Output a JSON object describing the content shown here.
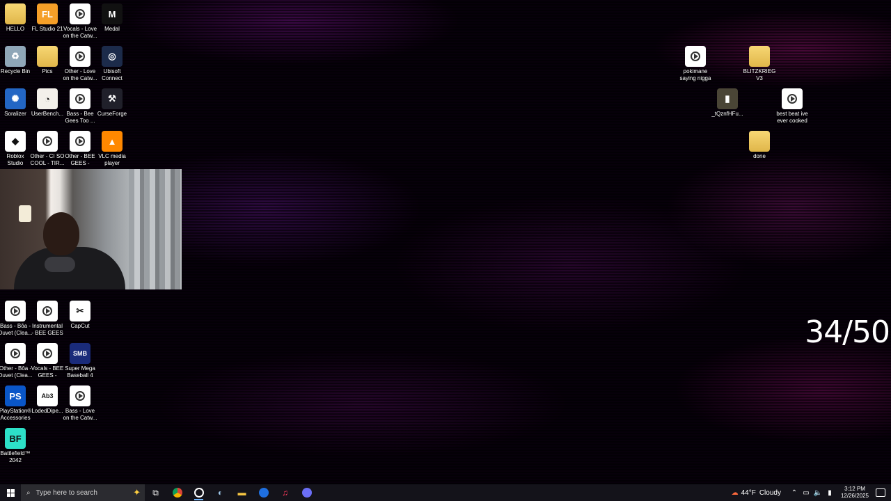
{
  "desktop_icons_left": [
    {
      "id": "hello",
      "label": "HELLO",
      "type": "folder"
    },
    {
      "id": "fl-studio",
      "label": "FL Studio 21",
      "type": "app",
      "color": "#f59f28",
      "glyph": "FL"
    },
    {
      "id": "vocals-love",
      "label": "Vocals - Love\non the Catw...",
      "type": "media"
    },
    {
      "id": "medal",
      "label": "Medal",
      "type": "app",
      "color": "#111",
      "glyph": "M"
    },
    {
      "id": "recycle-bin",
      "label": "Recycle Bin",
      "type": "app",
      "color": "#8fa7b8",
      "glyph": "♻"
    },
    {
      "id": "pics",
      "label": "Pics",
      "type": "folder"
    },
    {
      "id": "other-love",
      "label": "Other - Love\non the Catw...",
      "type": "media"
    },
    {
      "id": "ubisoft",
      "label": "Ubisoft\nConnect",
      "type": "app",
      "color": "#1c2b4a",
      "glyph": "◎"
    },
    {
      "id": "soralizer",
      "label": "Soralizer",
      "type": "app",
      "color": "#2366c4",
      "glyph": "✺"
    },
    {
      "id": "userbench",
      "label": "UserBench...",
      "type": "app",
      "color": "#f3f0ea",
      "glyph": "◔"
    },
    {
      "id": "bass-bee",
      "label": "Bass - Bee\nGees  Too ...",
      "type": "media"
    },
    {
      "id": "curseforge",
      "label": "CurseForge",
      "type": "app",
      "color": "#20202a",
      "glyph": "⚒"
    },
    {
      "id": "roblox",
      "label": "Roblox\nStudio",
      "type": "app",
      "color": "#fff",
      "glyph": "◆"
    },
    {
      "id": "other-ci-so",
      "label": "Other - CI SO\nCOOL - TIR...",
      "type": "media"
    },
    {
      "id": "other-bee",
      "label": "Other - BEE\nGEES - TOO...",
      "type": "media"
    },
    {
      "id": "vlc",
      "label": "VLC media\nplayer",
      "type": "app",
      "color": "#ff8800",
      "glyph": "▲"
    },
    {
      "id": "bass-boa",
      "label": "Bass - Bôa -\nDuvet (Clea...",
      "type": "media"
    },
    {
      "id": "instrumental",
      "label": "Instrumental\n- BEE GEES ...",
      "type": "media"
    },
    {
      "id": "capcut",
      "label": "CapCut",
      "type": "app",
      "color": "#fff",
      "glyph": "✂"
    },
    {
      "id": "other-boa",
      "label": "Other - Bôa -\nDuvet (Clea...",
      "type": "media"
    },
    {
      "id": "vocals-bee",
      "label": "Vocals - BEE\nGEES - TOO...",
      "type": "media"
    },
    {
      "id": "super-mega",
      "label": "Super Mega\nBaseball 4",
      "type": "app",
      "color": "#1a2b7a",
      "glyph": "SMB"
    },
    {
      "id": "ps-accessories",
      "label": "PlayStation®\nAccessories",
      "type": "app",
      "color": "#0a56c8",
      "glyph": "PS"
    },
    {
      "id": "loded-dipe",
      "label": "LodedDipe...",
      "type": "app",
      "color": "#fff",
      "glyph": "Ab3"
    },
    {
      "id": "bass-love",
      "label": "Bass - Love\non the Catw...",
      "type": "media"
    },
    {
      "id": "battlefield",
      "label": "Battlefield™\n2042",
      "type": "app",
      "color": "#2de0c8",
      "glyph": "BF"
    }
  ],
  "desktop_icons_right": [
    {
      "id": "pokimane",
      "label": "pokimane\nsaying nigga",
      "type": "media"
    },
    {
      "id": "blitzkrieg",
      "label": "BLITZKRIEG\nV3",
      "type": "folder"
    },
    {
      "id": "tqznf",
      "label": "_tQznfHFu...",
      "type": "app",
      "color": "#4a4536",
      "glyph": "▮"
    },
    {
      "id": "best-beat",
      "label": "best beat ive\never cooked",
      "type": "media"
    },
    {
      "id": "done",
      "label": "done",
      "type": "folder"
    }
  ],
  "overlay": {
    "counter": "34/50"
  },
  "taskbar": {
    "search_placeholder": "Type here to search",
    "weather": {
      "temp": "44°F",
      "condition": "Cloudy"
    },
    "clock": {
      "time": "3:12 PM",
      "date": "12/26/2025"
    }
  },
  "colors": {
    "taskbar": "#14131a",
    "accent": "#6fb6ff"
  }
}
